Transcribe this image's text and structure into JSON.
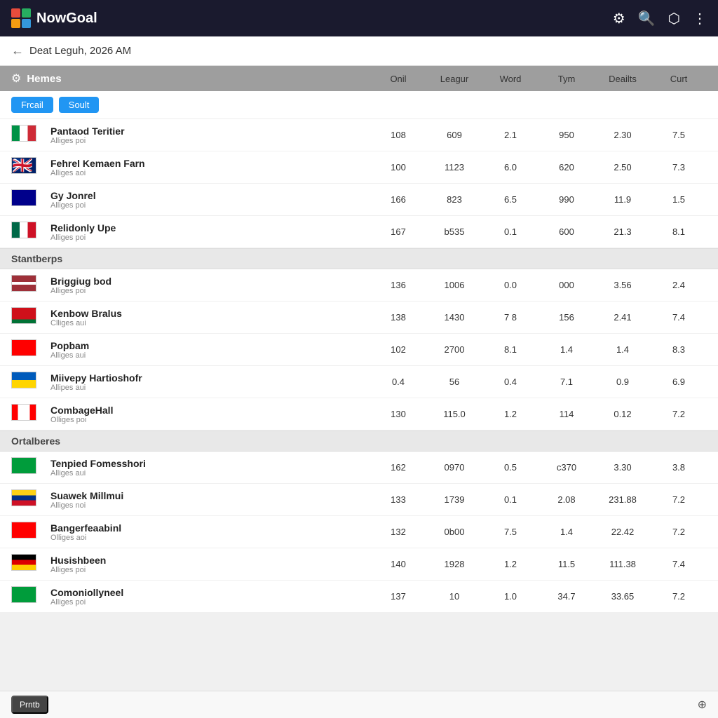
{
  "app": {
    "name": "NowGoal"
  },
  "top_icons": [
    "⚙",
    "🔍",
    "📷",
    "⋮"
  ],
  "sub_header": {
    "back": "←",
    "title": "Deat Leguh, 2026 AM"
  },
  "section": {
    "gear": "⚙",
    "title": "Hemes",
    "columns": [
      "Onil",
      "Leagur",
      "Word",
      "Tym",
      "Deailts",
      "Curt"
    ]
  },
  "filter_tabs": [
    {
      "label": "Frcail",
      "active": true
    },
    {
      "label": "Soult",
      "active": false
    }
  ],
  "groups": [
    {
      "label": "",
      "rows": [
        {
          "flag_class": "flag-italy",
          "name": "Pantaod Teritier",
          "sub": "Alliges poi",
          "cols": [
            "108",
            "609",
            "2.1",
            "950",
            "2.30",
            "7.5"
          ]
        },
        {
          "flag_class": "flag-uk",
          "name": "Fehrel Kemaen Farn",
          "sub": "Alliges aoi",
          "cols": [
            "100",
            "1123",
            "6.0",
            "620",
            "2.50",
            "7.3"
          ]
        },
        {
          "flag_class": "flag-australia",
          "name": "Gy Jonrel",
          "sub": "Alliges poi",
          "cols": [
            "166",
            "823",
            "6.5",
            "990",
            "11.9",
            "1.5"
          ]
        },
        {
          "flag_class": "flag-mexico",
          "name": "Relidonly Upe",
          "sub": "Alliges poi",
          "cols": [
            "167",
            "b535",
            "0.1",
            "600",
            "21.3",
            "8.1"
          ]
        }
      ]
    },
    {
      "label": "Stantberps",
      "rows": [
        {
          "flag_class": "flag-latvia",
          "name": "Briggiug bod",
          "sub": "Alliges poi",
          "cols": [
            "136",
            "1006",
            "0.0",
            "000",
            "3.56",
            "2.4"
          ]
        },
        {
          "flag_class": "flag-belarus",
          "name": "Kenbow Bralus",
          "sub": "Clliges aui",
          "cols": [
            "138",
            "1430",
            "7 8",
            "156",
            "2.41",
            "7.4"
          ]
        },
        {
          "flag_class": "flag-switzerland",
          "name": "Popbam",
          "sub": "Alliges aui",
          "cols": [
            "102",
            "2700",
            "8.1",
            "1.4",
            "1.4",
            "8.3"
          ]
        },
        {
          "flag_class": "flag-ukraine",
          "name": "Miivepy Hartioshofr",
          "sub": "Allipes aui",
          "cols": [
            "0.4",
            "56",
            "0.4",
            "7.1",
            "0.9",
            "6.9"
          ]
        },
        {
          "flag_class": "flag-canada",
          "name": "CombageHall",
          "sub": "Olliges poi",
          "cols": [
            "130",
            "115.0",
            "1.2",
            "114",
            "0.12",
            "7.2"
          ]
        }
      ]
    },
    {
      "label": "Ortalberes",
      "rows": [
        {
          "flag_class": "flag-brazil",
          "name": "Tenpied Fomesshori",
          "sub": "Alliges aui",
          "cols": [
            "162",
            "0970",
            "0.5",
            "c370",
            "3.30",
            "3.8"
          ]
        },
        {
          "flag_class": "flag-colombia",
          "name": "Suawek Millmui",
          "sub": "Alliges noi",
          "cols": [
            "133",
            "1739",
            "0.1",
            "2.08",
            "231.88",
            "7.2"
          ]
        },
        {
          "flag_class": "flag-swiss2",
          "name": "Bangerfeaabinl",
          "sub": "Olliges aoi",
          "cols": [
            "132",
            "0b00",
            "7.5",
            "1.4",
            "22.42",
            "7.2"
          ]
        },
        {
          "flag_class": "flag-germany",
          "name": "Husishbeen",
          "sub": "Alliges poi",
          "cols": [
            "140",
            "1928",
            "1.2",
            "11.5",
            "111.38",
            "7.4"
          ]
        },
        {
          "flag_class": "flag-green",
          "name": "Comoniollyneel",
          "sub": "Alliges poi",
          "cols": [
            "137",
            "10",
            "1.0",
            "34.7",
            "33.65",
            "7.2"
          ]
        }
      ]
    }
  ],
  "bottom_bar": {
    "promo_label": "Prntb",
    "scroll_icon": "⊕"
  }
}
